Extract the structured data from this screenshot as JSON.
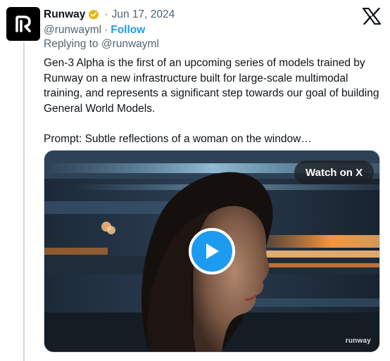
{
  "tweet": {
    "display_name": "Runway",
    "date": "Jun 17, 2024",
    "handle": "@runwayml",
    "follow_label": "Follow",
    "replying_to": "Replying to @runwayml",
    "body_paragraph_1": "Gen-3 Alpha is the first of an upcoming series of models trained by Runway on a new infrastructure built for large-scale multimodal training, and represents a significant step towards our goal of building General World Models.",
    "body_paragraph_2": "Prompt: Subtle reflections of a woman on the window…"
  },
  "media": {
    "watch_label": "Watch on X",
    "watermark": "runway"
  },
  "icons": {
    "avatar": "runway-logo-icon",
    "verified": "verified-badge-icon",
    "brand": "x-logo-icon",
    "play": "play-icon"
  },
  "colors": {
    "accent": "#1d9bf0",
    "verified_gold": "#e2b719",
    "muted_text": "#536471",
    "primary_text": "#0f1419"
  }
}
